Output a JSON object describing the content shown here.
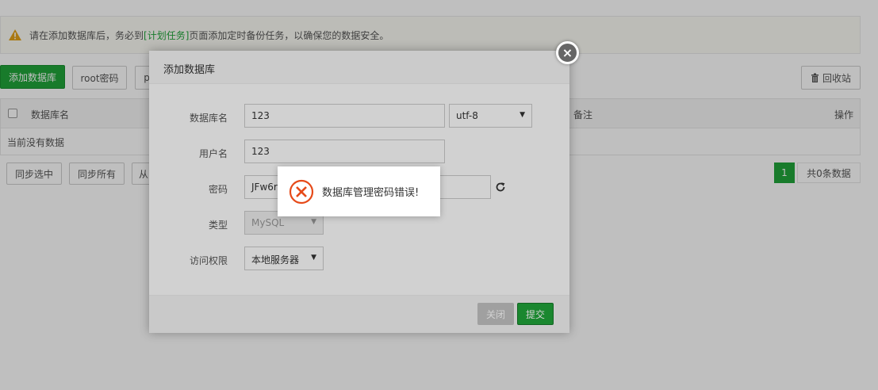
{
  "notice": {
    "prefix": "请在添加数据库后，务必到",
    "link": "[计划任务]",
    "suffix": "页面添加定时备份任务，以确保您的数据安全。"
  },
  "toolbar": {
    "add_db": "添加数据库",
    "root_pwd": "root密码",
    "phpmyadmin": "p",
    "recycle": "回收站"
  },
  "table": {
    "col_name": "数据库名",
    "col_note": "备注",
    "col_action": "操作",
    "empty": "当前没有数据"
  },
  "bottom": {
    "sync_selected": "同步选中",
    "sync_all": "同步所有",
    "from": "从"
  },
  "pager": {
    "current": "1",
    "total": "共0条数据"
  },
  "modal": {
    "title": "添加数据库",
    "db_name_label": "数据库名",
    "db_name_value": "123",
    "charset": "utf-8",
    "user_label": "用户名",
    "user_value": "123",
    "pwd_label": "密码",
    "pwd_value": "JFw6r2",
    "type_label": "类型",
    "type_value": "MySQL",
    "access_label": "访问权限",
    "access_value": "本地服务器",
    "close_btn": "关闭",
    "submit_btn": "提交",
    "close_x": "×"
  },
  "toast": {
    "message": "数据库管理密码错误!"
  },
  "colors": {
    "accent": "#20a53a",
    "error": "#e64a19"
  }
}
